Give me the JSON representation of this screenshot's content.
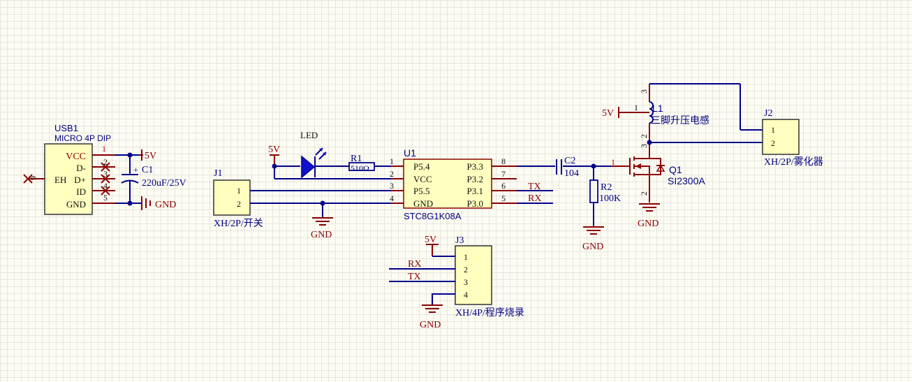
{
  "usb1": {
    "designator": "USB1",
    "part": "MICRO 4P DIP",
    "pins": [
      "VCC",
      "D-",
      "D+",
      "ID",
      "GND"
    ],
    "eh_label": "EH",
    "pin_numbers": [
      "1",
      "2",
      "3",
      "4",
      "5",
      "6"
    ]
  },
  "c1": {
    "designator": "C1",
    "value": "220uF/25V",
    "polarity": "+"
  },
  "c2": {
    "designator": "C2",
    "value": "104"
  },
  "r1": {
    "designator": "R1",
    "value": "510Ω"
  },
  "r2": {
    "designator": "R2",
    "value": "100K"
  },
  "led": {
    "label": "LED"
  },
  "u1": {
    "designator": "U1",
    "part": "STC8G1K08A",
    "left_pins": [
      {
        "num": "1",
        "name": "P5.4"
      },
      {
        "num": "2",
        "name": "VCC"
      },
      {
        "num": "3",
        "name": "P5.5"
      },
      {
        "num": "4",
        "name": "GND"
      }
    ],
    "right_pins": [
      {
        "num": "8",
        "name": "P3.3"
      },
      {
        "num": "7",
        "name": "P3.2"
      },
      {
        "num": "6",
        "name": "P3.1"
      },
      {
        "num": "5",
        "name": "P3.0"
      }
    ]
  },
  "j1": {
    "designator": "J1",
    "part": "XH/2P/开关",
    "pins": [
      "1",
      "2"
    ]
  },
  "j2": {
    "designator": "J2",
    "part": "XH/2P/雾化器",
    "pins": [
      "1",
      "2"
    ]
  },
  "j3": {
    "designator": "J3",
    "part": "XH/4P/程序烧录",
    "pins": [
      "1",
      "2",
      "3",
      "4"
    ]
  },
  "l1": {
    "designator": "L1",
    "part": "三脚升压电感",
    "pins": [
      "1",
      "2",
      "3"
    ]
  },
  "q1": {
    "designator": "Q1",
    "part": "SI2300A",
    "pins": [
      "1",
      "2",
      "3"
    ]
  },
  "nets": {
    "five_v": "5V",
    "gnd": "GND",
    "tx": "TX",
    "rx": "RX"
  }
}
